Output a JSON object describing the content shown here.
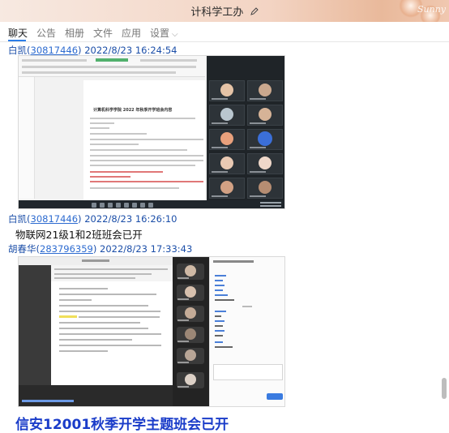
{
  "window": {
    "title": "计科学工办",
    "edit_icon": "edit-pencil-icon",
    "background_text": "Sunny"
  },
  "tabs": [
    {
      "label": "聊天",
      "active": true
    },
    {
      "label": "公告",
      "active": false
    },
    {
      "label": "相册",
      "active": false
    },
    {
      "label": "文件",
      "active": false
    },
    {
      "label": "应用",
      "active": false
    },
    {
      "label": "设置",
      "active": false,
      "has_dropdown": true
    }
  ],
  "messages": [
    {
      "sender_name": "白凯",
      "sender_id": "30817446",
      "timestamp": "2022/8/23 16:24:54",
      "type": "image",
      "image": {
        "doc_title": "计算机科学学院 2022 年秋季开学班会内容",
        "description": "word-document-and-video-meeting-screenshot"
      }
    },
    {
      "sender_name": "白凯",
      "sender_id": "30817446",
      "timestamp": "2022/8/23 16:26:10",
      "type": "text",
      "text": "物联网21级1和2班班会已开"
    },
    {
      "sender_name": "胡春华",
      "sender_id": "283796359",
      "timestamp": "2022/8/23 17:33:43",
      "type": "image",
      "image": {
        "description": "tencent-meeting-screenshot"
      }
    },
    {
      "type": "text",
      "style": "bold-large-blue",
      "text": "信安12001秋季开学主题班会已开"
    }
  ],
  "colors": {
    "sender": "#1b4ea8",
    "sender_id": "#2d6bd0",
    "active_tab_underline": "#2d7ee8",
    "highlight_message": "#1a3cc9"
  }
}
